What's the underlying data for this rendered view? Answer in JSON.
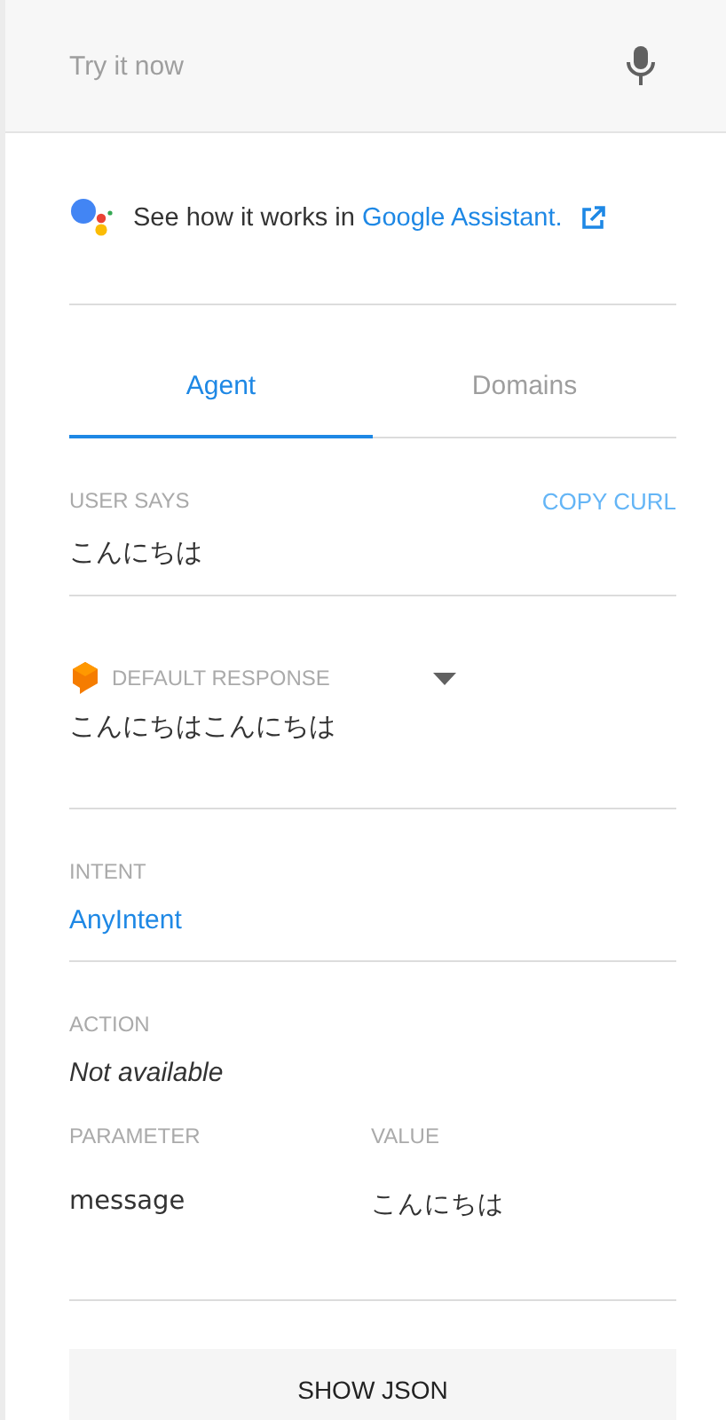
{
  "query_bar": {
    "placeholder": "Try it now"
  },
  "assistant": {
    "text": "See how it works in ",
    "link": "Google Assistant."
  },
  "tabs": [
    {
      "label": "Agent",
      "selected": true
    },
    {
      "label": "Domains",
      "selected": false
    }
  ],
  "user_says": {
    "label": "USER SAYS",
    "action": "COPY CURL",
    "value": "こんにちは"
  },
  "response": {
    "label": "DEFAULT RESPONSE",
    "value": "こんにちはこんにちは"
  },
  "intent": {
    "label": "INTENT",
    "value": "AnyIntent"
  },
  "action": {
    "label": "ACTION",
    "value": "Not available"
  },
  "parameters": {
    "columns": [
      "PARAMETER",
      "VALUE"
    ],
    "rows": [
      [
        "message",
        "こんにちは"
      ]
    ]
  },
  "button": "SHOW JSON"
}
